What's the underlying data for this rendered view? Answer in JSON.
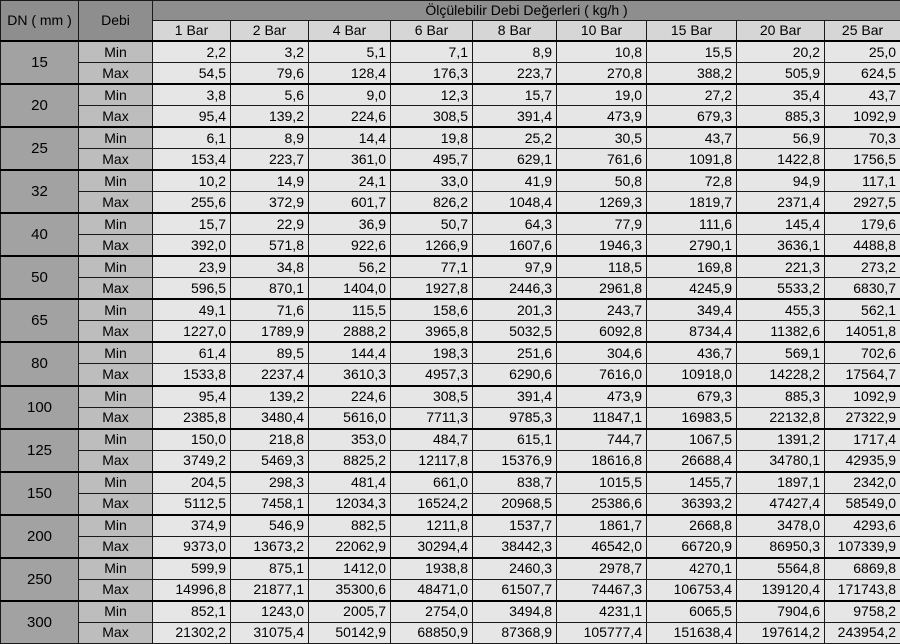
{
  "header": {
    "dn_label": "DN ( mm )",
    "debi_label": "Debi",
    "group_title": "Ölçülebilir Debi Değerleri ( kg/h )",
    "pressures": [
      "1 Bar",
      "2 Bar",
      "4 Bar",
      "6 Bar",
      "8 Bar",
      "10 Bar",
      "15 Bar",
      "20 Bar",
      "25 Bar"
    ]
  },
  "row_labels": {
    "min": "Min",
    "max": "Max"
  },
  "rows": [
    {
      "dn": "15",
      "min": [
        "2,2",
        "3,2",
        "5,1",
        "7,1",
        "8,9",
        "10,8",
        "15,5",
        "20,2",
        "25,0"
      ],
      "max": [
        "54,5",
        "79,6",
        "128,4",
        "176,3",
        "223,7",
        "270,8",
        "388,2",
        "505,9",
        "624,5"
      ]
    },
    {
      "dn": "20",
      "min": [
        "3,8",
        "5,6",
        "9,0",
        "12,3",
        "15,7",
        "19,0",
        "27,2",
        "35,4",
        "43,7"
      ],
      "max": [
        "95,4",
        "139,2",
        "224,6",
        "308,5",
        "391,4",
        "473,9",
        "679,3",
        "885,3",
        "1092,9"
      ]
    },
    {
      "dn": "25",
      "min": [
        "6,1",
        "8,9",
        "14,4",
        "19,8",
        "25,2",
        "30,5",
        "43,7",
        "56,9",
        "70,3"
      ],
      "max": [
        "153,4",
        "223,7",
        "361,0",
        "495,7",
        "629,1",
        "761,6",
        "1091,8",
        "1422,8",
        "1756,5"
      ]
    },
    {
      "dn": "32",
      "min": [
        "10,2",
        "14,9",
        "24,1",
        "33,0",
        "41,9",
        "50,8",
        "72,8",
        "94,9",
        "117,1"
      ],
      "max": [
        "255,6",
        "372,9",
        "601,7",
        "826,2",
        "1048,4",
        "1269,3",
        "1819,7",
        "2371,4",
        "2927,5"
      ]
    },
    {
      "dn": "40",
      "min": [
        "15,7",
        "22,9",
        "36,9",
        "50,7",
        "64,3",
        "77,9",
        "111,6",
        "145,4",
        "179,6"
      ],
      "max": [
        "392,0",
        "571,8",
        "922,6",
        "1266,9",
        "1607,6",
        "1946,3",
        "2790,1",
        "3636,1",
        "4488,8"
      ]
    },
    {
      "dn": "50",
      "min": [
        "23,9",
        "34,8",
        "56,2",
        "77,1",
        "97,9",
        "118,5",
        "169,8",
        "221,3",
        "273,2"
      ],
      "max": [
        "596,5",
        "870,1",
        "1404,0",
        "1927,8",
        "2446,3",
        "2961,8",
        "4245,9",
        "5533,2",
        "6830,7"
      ]
    },
    {
      "dn": "65",
      "min": [
        "49,1",
        "71,6",
        "115,5",
        "158,6",
        "201,3",
        "243,7",
        "349,4",
        "455,3",
        "562,1"
      ],
      "max": [
        "1227,0",
        "1789,9",
        "2888,2",
        "3965,8",
        "5032,5",
        "6092,8",
        "8734,4",
        "11382,6",
        "14051,8"
      ]
    },
    {
      "dn": "80",
      "min": [
        "61,4",
        "89,5",
        "144,4",
        "198,3",
        "251,6",
        "304,6",
        "436,7",
        "569,1",
        "702,6"
      ],
      "max": [
        "1533,8",
        "2237,4",
        "3610,3",
        "4957,3",
        "6290,6",
        "7616,0",
        "10918,0",
        "14228,2",
        "17564,7"
      ]
    },
    {
      "dn": "100",
      "min": [
        "95,4",
        "139,2",
        "224,6",
        "308,5",
        "391,4",
        "473,9",
        "679,3",
        "885,3",
        "1092,9"
      ],
      "max": [
        "2385,8",
        "3480,4",
        "5616,0",
        "7711,3",
        "9785,3",
        "11847,1",
        "16983,5",
        "22132,8",
        "27322,9"
      ]
    },
    {
      "dn": "125",
      "min": [
        "150,0",
        "218,8",
        "353,0",
        "484,7",
        "615,1",
        "744,7",
        "1067,5",
        "1391,2",
        "1717,4"
      ],
      "max": [
        "3749,2",
        "5469,3",
        "8825,2",
        "12117,8",
        "15376,9",
        "18616,8",
        "26688,4",
        "34780,1",
        "42935,9"
      ]
    },
    {
      "dn": "150",
      "min": [
        "204,5",
        "298,3",
        "481,4",
        "661,0",
        "838,7",
        "1015,5",
        "1455,7",
        "1897,1",
        "2342,0"
      ],
      "max": [
        "5112,5",
        "7458,1",
        "12034,3",
        "16524,2",
        "20968,5",
        "25386,6",
        "36393,2",
        "47427,4",
        "58549,0"
      ]
    },
    {
      "dn": "200",
      "min": [
        "374,9",
        "546,9",
        "882,5",
        "1211,8",
        "1537,7",
        "1861,7",
        "2668,8",
        "3478,0",
        "4293,6"
      ],
      "max": [
        "9373,0",
        "13673,2",
        "22062,9",
        "30294,4",
        "38442,3",
        "46542,0",
        "66720,9",
        "86950,3",
        "107339,9"
      ]
    },
    {
      "dn": "250",
      "min": [
        "599,9",
        "875,1",
        "1412,0",
        "1938,8",
        "2460,3",
        "2978,7",
        "4270,1",
        "5564,8",
        "6869,8"
      ],
      "max": [
        "14996,8",
        "21877,1",
        "35300,6",
        "48471,0",
        "61507,7",
        "74467,3",
        "106753,4",
        "139120,4",
        "171743,8"
      ]
    },
    {
      "dn": "300",
      "min": [
        "852,1",
        "1243,0",
        "2005,7",
        "2754,0",
        "3494,8",
        "4231,1",
        "6065,5",
        "7904,6",
        "9758,2"
      ],
      "max": [
        "21302,2",
        "31075,4",
        "50142,9",
        "68850,9",
        "87368,9",
        "105777,4",
        "151638,4",
        "197614,2",
        "243954,2"
      ]
    }
  ]
}
